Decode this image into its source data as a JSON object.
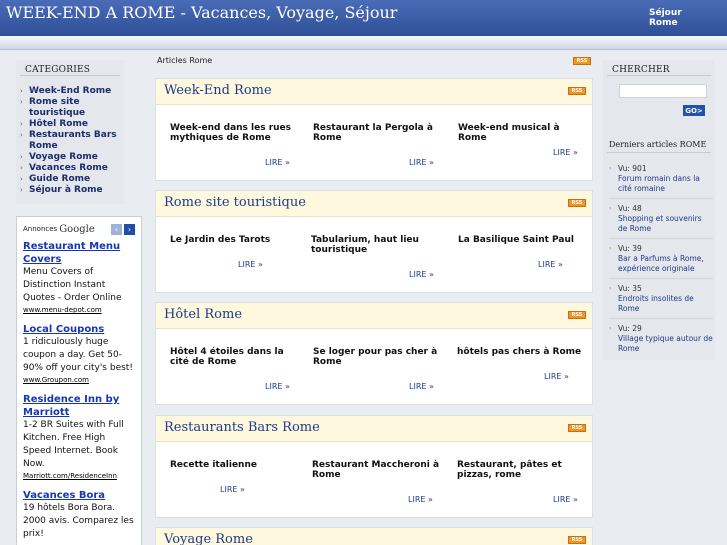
{
  "header": {
    "title": "WEEK-END A ROME - Vacances, Voyage, Séjour",
    "link": "Séjour Rome"
  },
  "categories": {
    "title": "CATEGORIES",
    "items": [
      "Week-End Rome",
      "Rome site touristique",
      "Hôtel Rome",
      "Restaurants Bars Rome",
      "Voyage Rome",
      "Vacances Rome",
      "Guide Rome",
      "Séjour à Rome"
    ]
  },
  "ads": {
    "label": "Annonces",
    "brand": "Google",
    "items": [
      {
        "title": "Restaurant Menu Covers",
        "text": "Menu Covers of Distinction Instant Quotes - Order Online",
        "url": "www.menu-depot.com"
      },
      {
        "title": "Local Coupons",
        "text": "1 ridiculously huge coupon a day. Get 50-90% off your city's best!",
        "url": "www.Groupon.com"
      },
      {
        "title": "Residence Inn by Marriott",
        "text": "1-2 BR Suites with Full Kitchen. Free High Speed Internet. Book Now.",
        "url": "Marriott.com/ResidenceInn"
      },
      {
        "title": "Vacances Bora",
        "text": "19 hôtels Bora Bora. 2000 avis. Comparez les prix!",
        "url": ""
      }
    ]
  },
  "breadcrumb": "Articles Rome",
  "rss_label": "RSS",
  "more_label": "LIRE »",
  "sections": [
    {
      "title": "Week-End Rome",
      "articles": [
        "Week-end dans les rues mythiques de Rome",
        "Restaurant la Pergola à Rome",
        "Week-end musical à Rome"
      ]
    },
    {
      "title": "Rome site touristique",
      "articles": [
        "Le Jardin des Tarots",
        "Tabularium, haut lieu touristique",
        "La Basilique Saint Paul"
      ]
    },
    {
      "title": "Hôtel Rome",
      "articles": [
        "Hôtel 4 étoiles dans la cité de Rome",
        "Se loger pour pas cher à Rome",
        "hôtels pas chers à Rome"
      ]
    },
    {
      "title": "Restaurants Bars Rome",
      "articles": [
        "Recette italienne",
        "Restaurant Maccheroni à Rome",
        "Restaurant, pâtes et pizzas, rome"
      ]
    },
    {
      "title": "Voyage Rome",
      "articles": []
    }
  ],
  "search": {
    "title": "CHERCHER",
    "button": "GO>"
  },
  "latest": {
    "title": "Derniers articles ROME",
    "items": [
      {
        "views": "Vu: 901",
        "link": "Forum romain dans la cité romaine"
      },
      {
        "views": "Vu: 48",
        "link": "Shopping et souvenirs de Rome"
      },
      {
        "views": "Vu: 39",
        "link": "Bar a Parfums à Rome, expérience originale"
      },
      {
        "views": "Vu: 35",
        "link": "Endroits insolites de Rome"
      },
      {
        "views": "Vu: 29",
        "link": "Village typique autour de Rome"
      }
    ]
  }
}
